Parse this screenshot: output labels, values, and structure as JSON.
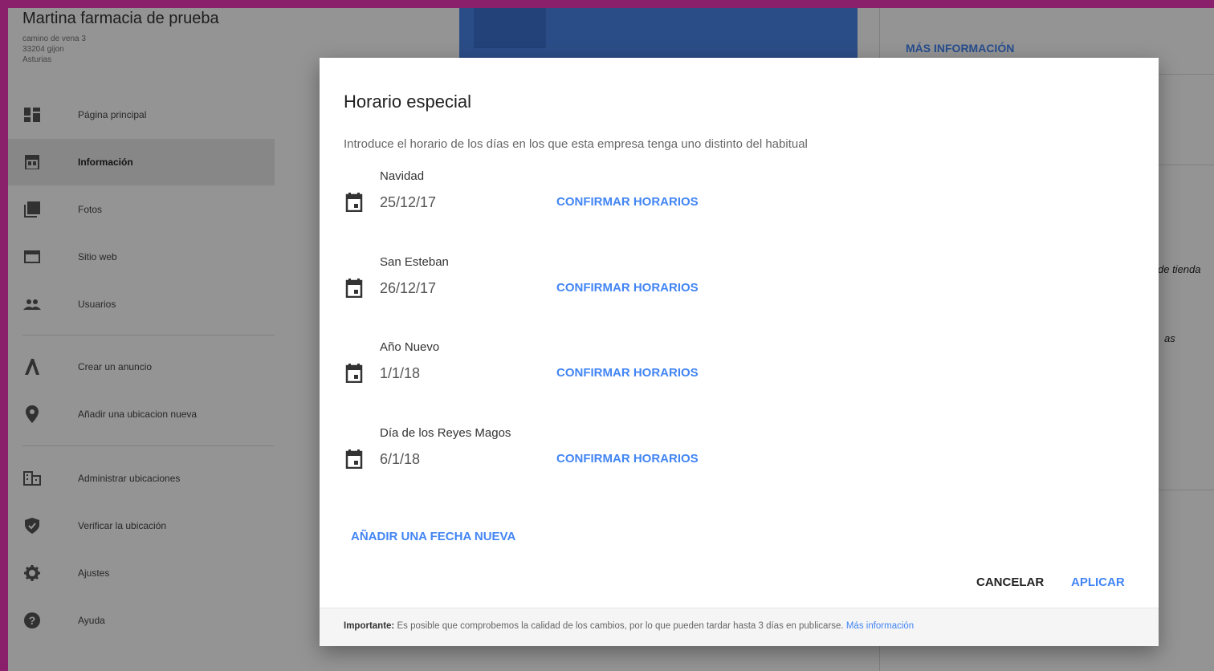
{
  "business": {
    "name": "Martina farmacia de prueba",
    "address_line1": "camino de vena 3",
    "address_line2": "33204 gijon",
    "address_line3": "Asturias"
  },
  "sidebar": {
    "items": [
      {
        "label": "Página principal",
        "icon": "dashboard-icon"
      },
      {
        "label": "Información",
        "icon": "storefront-icon"
      },
      {
        "label": "Fotos",
        "icon": "photos-icon"
      },
      {
        "label": "Sitio web",
        "icon": "website-icon"
      },
      {
        "label": "Usuarios",
        "icon": "people-icon"
      },
      {
        "label": "Crear un anuncio",
        "icon": "ads-icon"
      },
      {
        "label": "Añadir una ubicacion nueva",
        "icon": "location-pin-icon"
      },
      {
        "label": "Administrar ubicaciones",
        "icon": "building-icon"
      },
      {
        "label": "Verificar la ubicación",
        "icon": "shield-icon"
      },
      {
        "label": "Ajustes",
        "icon": "gear-icon"
      },
      {
        "label": "Ayuda",
        "icon": "help-icon"
      }
    ],
    "active_index": 1
  },
  "background": {
    "more_info": "MÁS INFORMACIÓN",
    "fragment1": "de tienda",
    "fragment2": "as"
  },
  "dialog": {
    "title": "Horario especial",
    "subtitle": "Introduce el horario de los días en los que esta empresa tenga uno distinto del habitual",
    "holidays": [
      {
        "name": "Navidad",
        "date": "25/12/17",
        "action": "CONFIRMAR HORARIOS"
      },
      {
        "name": "San Esteban",
        "date": "26/12/17",
        "action": "CONFIRMAR HORARIOS"
      },
      {
        "name": "Año Nuevo",
        "date": "1/1/18",
        "action": "CONFIRMAR HORARIOS"
      },
      {
        "name": "Día de los Reyes Magos",
        "date": "6/1/18",
        "action": "CONFIRMAR HORARIOS"
      }
    ],
    "add_date": "AÑADIR UNA FECHA NUEVA",
    "cancel": "CANCELAR",
    "apply": "APLICAR",
    "footer": {
      "label": "Importante:",
      "text": "Es posible que comprobemos la calidad de los cambios, por lo que pueden tardar hasta 3 días en publicarse.",
      "link": "Más información"
    }
  },
  "colors": {
    "accent": "#4285f4",
    "frame": "#8a1f6b",
    "scrim": "rgba(0,0,0,0.42)"
  }
}
